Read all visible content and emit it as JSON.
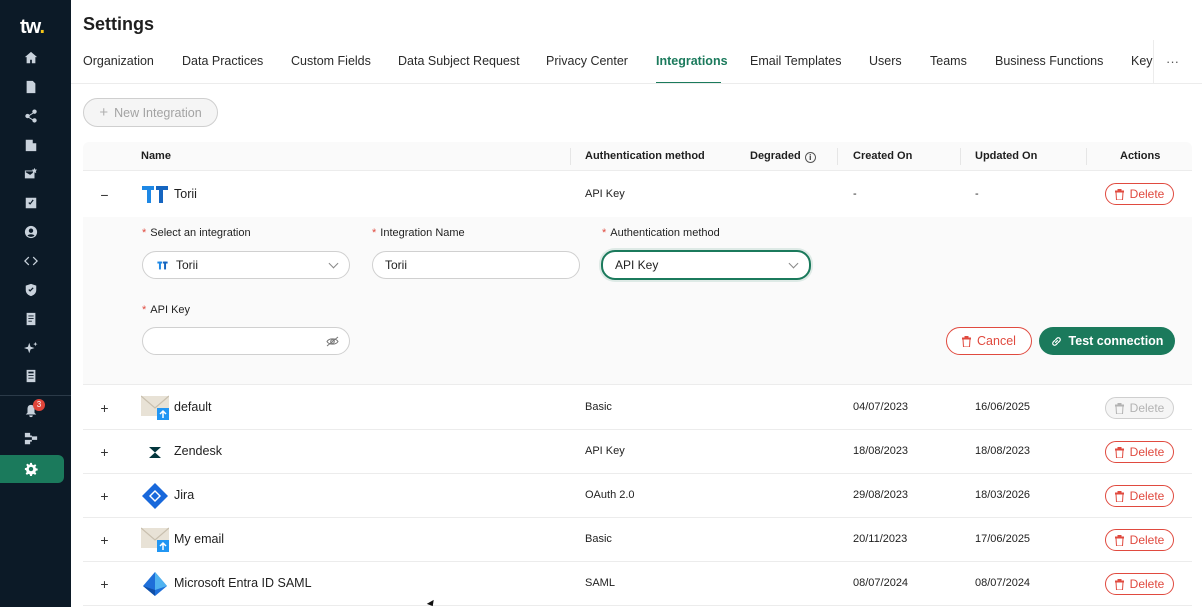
{
  "app": {
    "logo_text": "tw",
    "logo_dot": "."
  },
  "sidebar": {
    "icons": [
      "home-icon",
      "document-icon",
      "share-icon",
      "building-icon",
      "mail-check-icon",
      "checklist-icon",
      "user-circle-icon",
      "code-icon",
      "shield-icon",
      "report-icon",
      "sparkle-icon",
      "book-icon",
      "bell-icon",
      "hierarchy-icon",
      "gear-icon"
    ],
    "notification_count": "3"
  },
  "header": {
    "title": "Settings",
    "tabs": [
      {
        "label": "Organization"
      },
      {
        "label": "Data Practices"
      },
      {
        "label": "Custom Fields"
      },
      {
        "label": "Data Subject Request"
      },
      {
        "label": "Privacy Center"
      },
      {
        "label": "Integrations"
      },
      {
        "label": "Email Templates"
      },
      {
        "label": "Users"
      },
      {
        "label": "Teams"
      },
      {
        "label": "Business Functions"
      },
      {
        "label": "Key"
      }
    ],
    "more_label": "···"
  },
  "toolbar": {
    "new_integration_label": "New Integration"
  },
  "table": {
    "columns": [
      "Name",
      "Authentication method",
      "Degraded",
      "Created On",
      "Updated On",
      "Actions"
    ],
    "degraded_info": "i",
    "delete_label": "Delete",
    "rows": [
      {
        "name": "Torii",
        "auth": "API Key",
        "created": "-",
        "updated": "-",
        "expanded": true,
        "logo": "torii-logo"
      },
      {
        "name": "default",
        "auth": "Basic",
        "created": "04/07/2023",
        "updated": "16/06/2025",
        "logo": "email-logo",
        "delete_disabled": true
      },
      {
        "name": "Zendesk",
        "auth": "API Key",
        "created": "18/08/2023",
        "updated": "18/08/2023",
        "logo": "zendesk-logo"
      },
      {
        "name": "Jira",
        "auth": "OAuth 2.0",
        "created": "29/08/2023",
        "updated": "18/03/2026",
        "logo": "jira-logo"
      },
      {
        "name": "My email",
        "auth": "Basic",
        "created": "20/11/2023",
        "updated": "17/06/2025",
        "logo": "email-logo"
      },
      {
        "name": "Microsoft Entra ID SAML",
        "auth": "SAML",
        "created": "08/07/2024",
        "updated": "08/07/2024",
        "logo": "entra-logo"
      }
    ]
  },
  "form": {
    "required_mark": "*",
    "select_integration_label": "Select an integration",
    "select_integration_value": "Torii",
    "integration_name_label": "Integration Name",
    "integration_name_value": "Torii",
    "auth_method_label": "Authentication method",
    "auth_method_value": "API Key",
    "api_key_label": "API Key",
    "api_key_value": "",
    "cancel_label": "Cancel",
    "test_label": "Test connection"
  },
  "colors": {
    "brand": "#1b7a5c",
    "danger": "#e04a3f",
    "sidebar": "#0c1a27"
  }
}
